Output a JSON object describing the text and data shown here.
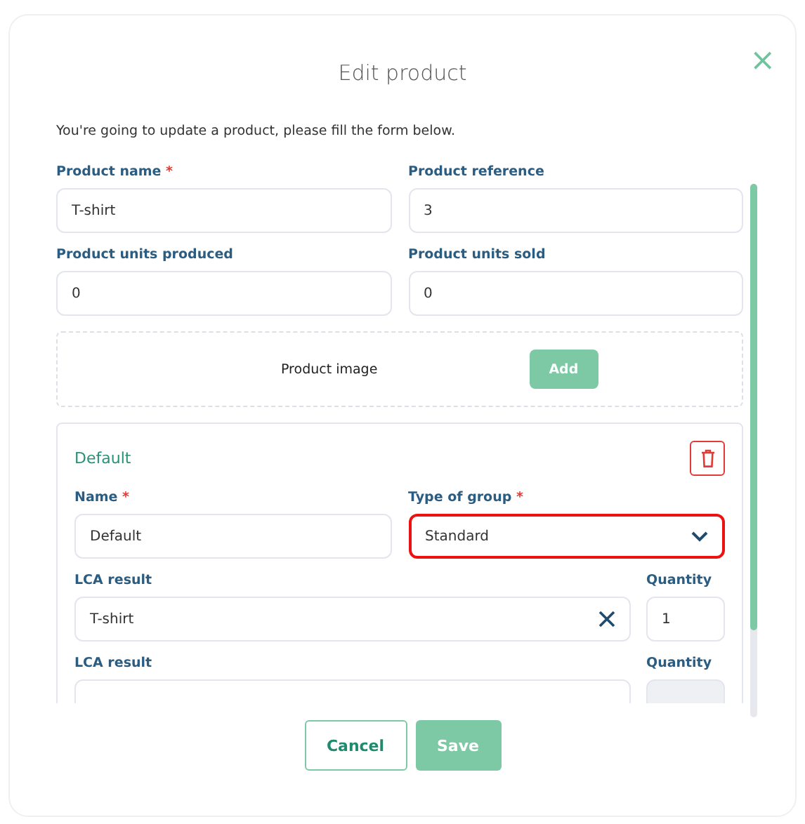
{
  "dialog": {
    "title": "Edit product",
    "close": "×",
    "intro": "You're going to update a product, please fill the form below."
  },
  "fields": [
    {
      "label": "Product name",
      "required_mark": "*",
      "value": "T-shirt"
    },
    {
      "label": "Product reference",
      "value": "3"
    },
    {
      "label": "Product units produced",
      "value": "0"
    },
    {
      "label": "Product units sold",
      "value": "0"
    }
  ],
  "image": {
    "label": "Product image",
    "button": "Add"
  },
  "group": {
    "title": "Default",
    "name": {
      "label": "Name",
      "required_mark": "*",
      "value": "Default"
    },
    "type": {
      "label": "Type of group",
      "required_mark": "*",
      "value": "Standard",
      "error": true
    },
    "lca_rows": [
      {
        "label": "LCA result",
        "value": "T-shirt",
        "clearable": true,
        "quantity_label": "Quantity",
        "quantity": "1",
        "quantity_disabled": false
      },
      {
        "label": "LCA result",
        "clearable": false,
        "quantity_label": "Quantity",
        "quantity_disabled": true
      }
    ]
  },
  "buttons": [
    {
      "label": "Cancel",
      "kind": "secondary"
    },
    {
      "label": "Save",
      "kind": "primary"
    }
  ]
}
